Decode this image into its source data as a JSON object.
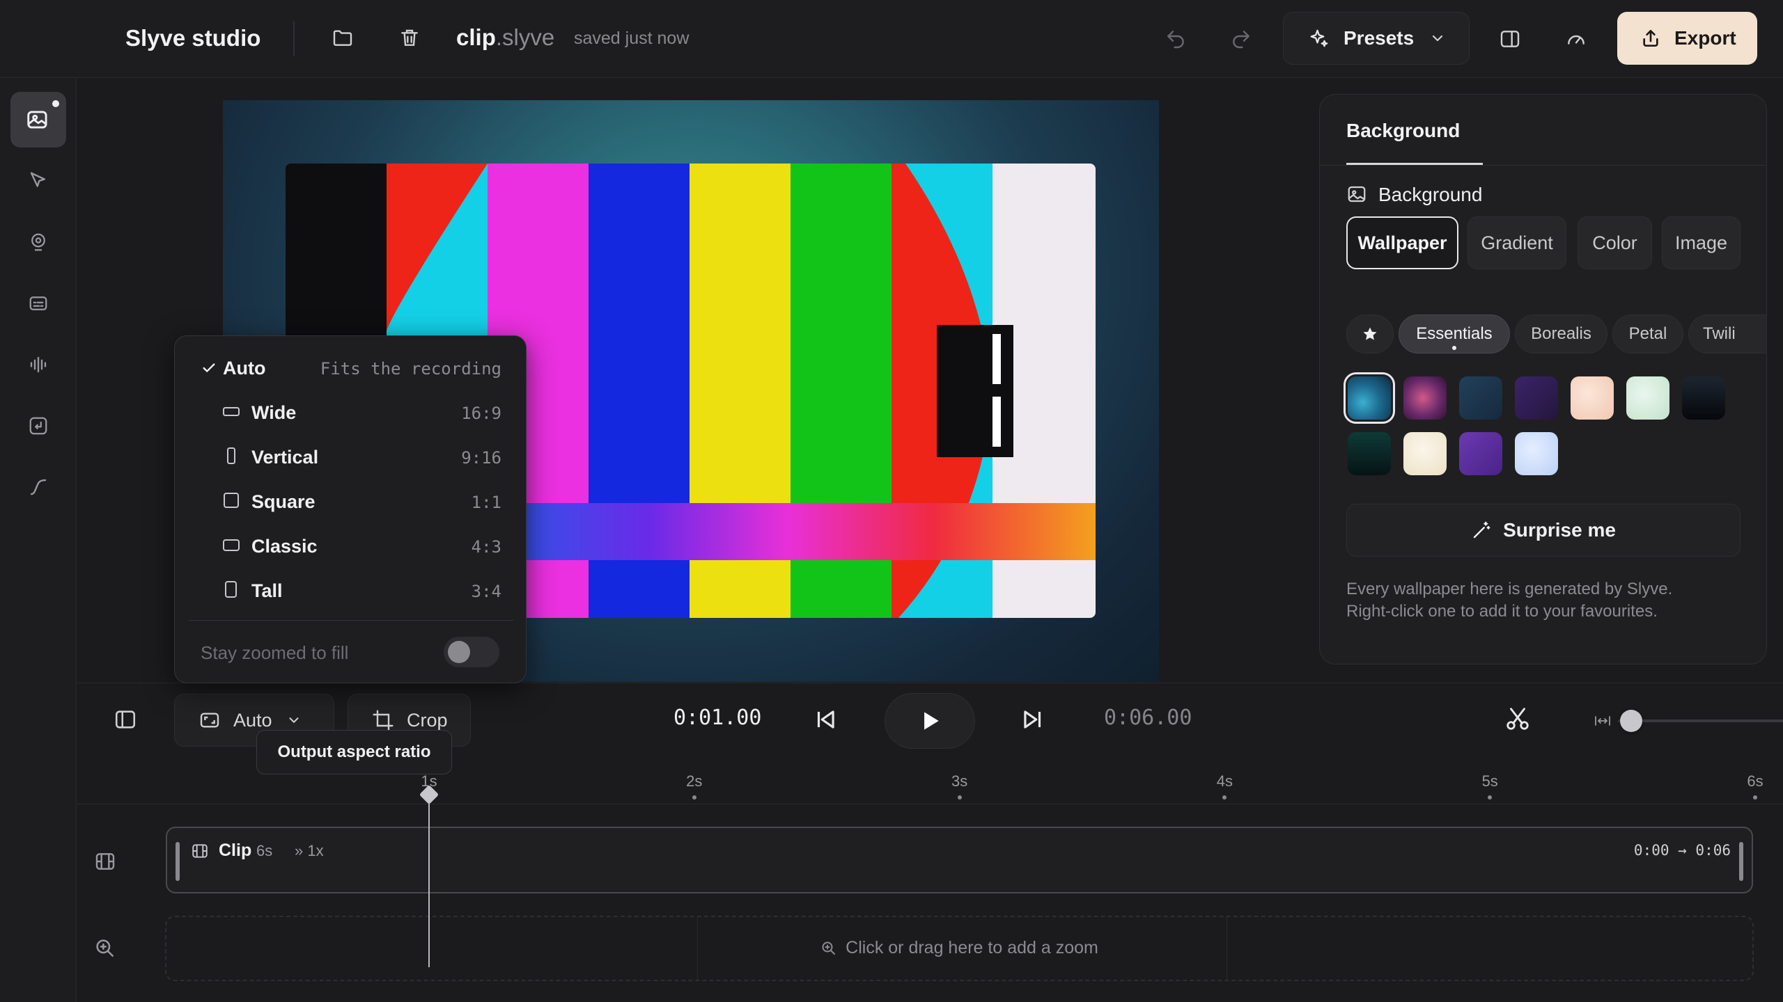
{
  "app": {
    "title": "Slyve studio"
  },
  "file": {
    "name": "clip",
    "ext": ".slyve",
    "status": "saved just now"
  },
  "toolbar": {
    "presets_label": "Presets",
    "export_label": "Export"
  },
  "panel": {
    "tab_label": "Background",
    "section_title": "Background",
    "modes": [
      "Wallpaper",
      "Gradient",
      "Color",
      "Image"
    ],
    "active_mode": "Wallpaper",
    "collections": [
      "Essentials",
      "Borealis",
      "Petal",
      "Twili"
    ],
    "active_collection": "Essentials",
    "swatch_colors": [
      "#2a8ab0",
      "#8a3a70",
      "#1e3a52",
      "#2e1e50",
      "#f6d8c8",
      "#d8eedd",
      "#0e1218",
      "#0a2a28",
      "#f4eee0",
      "#5a30a0",
      "#d0e0ff"
    ],
    "surprise_label": "Surprise me",
    "note_line1": "Every wallpaper here is generated by Slyve.",
    "note_line2": "Right-click one to add it to your favourites."
  },
  "aspect_menu": {
    "items": [
      {
        "label": "Auto",
        "ratio": "Fits the recording",
        "checked": true
      },
      {
        "label": "Wide",
        "ratio": "16:9"
      },
      {
        "label": "Vertical",
        "ratio": "9:16"
      },
      {
        "label": "Square",
        "ratio": "1:1"
      },
      {
        "label": "Classic",
        "ratio": "4:3"
      },
      {
        "label": "Tall",
        "ratio": "3:4"
      }
    ],
    "toggle_label": "Stay zoomed to fill",
    "toggle_on": false
  },
  "controls": {
    "aspect_label": "Auto",
    "crop_label": "Crop",
    "tooltip": "Output aspect ratio",
    "current_time": "0:01.00",
    "total_time": "0:06.00",
    "zoom_level": 0.06
  },
  "timeline": {
    "ticks": [
      "1s",
      "2s",
      "3s",
      "4s",
      "5s",
      "6s"
    ],
    "playhead_seconds": 1,
    "clip": {
      "label": "Clip",
      "duration": "6s",
      "speed": "» 1x",
      "range": "0:00 → 0:06"
    },
    "zoom_hint": "Click or drag here to add a zoom"
  },
  "colors": {
    "accent_export": "#f3e2cf",
    "canvas_bg": "#1b1b1d"
  }
}
